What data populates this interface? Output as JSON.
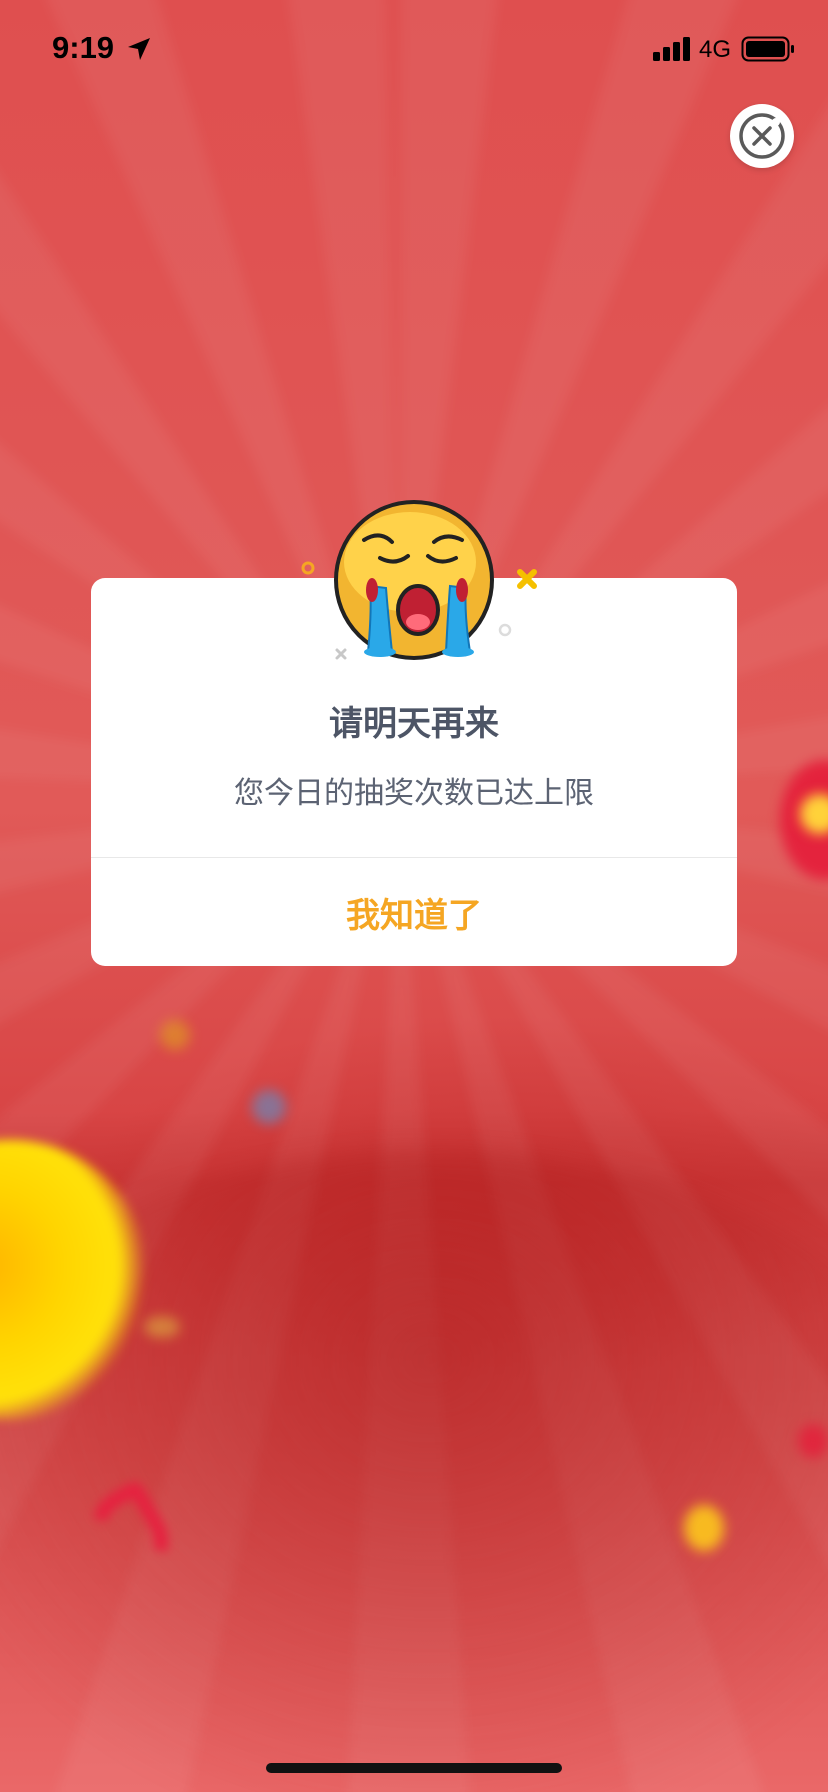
{
  "status_bar": {
    "time": "9:19",
    "network": "4G"
  },
  "dialog": {
    "title": "请明天再来",
    "message": "您今日的抽奖次数已达上限",
    "confirm_label": "我知道了"
  },
  "icons": {
    "close": "close-icon",
    "emoji": "crying-face-icon"
  },
  "colors": {
    "background": "#df4f4f",
    "title_text": "#4d5566",
    "confirm_text": "#f5a623"
  }
}
